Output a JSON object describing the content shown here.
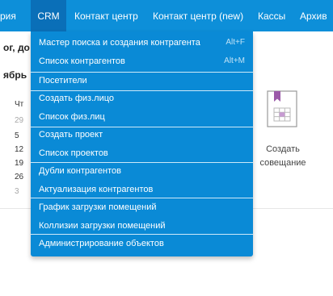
{
  "nav": {
    "items": [
      {
        "label": "рия"
      },
      {
        "label": "CRM"
      },
      {
        "label": "Контакт центр"
      },
      {
        "label": "Контакт центр (new)"
      },
      {
        "label": "Кассы"
      },
      {
        "label": "Архив"
      }
    ]
  },
  "background": {
    "heading": "ог, до",
    "month": "ябрь",
    "weekday": "Чт",
    "dates": [
      "29",
      "5",
      "12",
      "19",
      "26",
      "3"
    ],
    "create_meeting_line1": "Создать",
    "create_meeting_line2": "совещание"
  },
  "crm_menu": {
    "items": [
      {
        "label": "Мастер поиска и создания контрагента",
        "shortcut": "Alt+F"
      },
      {
        "label": "Список контрагентов",
        "shortcut": "Alt+M"
      },
      {
        "label": "Посетители"
      },
      {
        "label": "Создать физ.лицо"
      },
      {
        "label": "Список физ.лиц"
      },
      {
        "label": "Создать проект"
      },
      {
        "label": "Список проектов"
      },
      {
        "label": "Дубли контрагентов"
      },
      {
        "label": "Актуализация контрагентов"
      },
      {
        "label": "График загрузки помещений"
      },
      {
        "label": "Коллизии загрузки помещений"
      },
      {
        "label": "Администрирование объектов"
      }
    ]
  },
  "colors": {
    "nav_bg": "#0d8fd9",
    "nav_active": "#0a6fb8",
    "menu_bg": "#0a8ad6",
    "icon_accent": "#9b59a8"
  }
}
